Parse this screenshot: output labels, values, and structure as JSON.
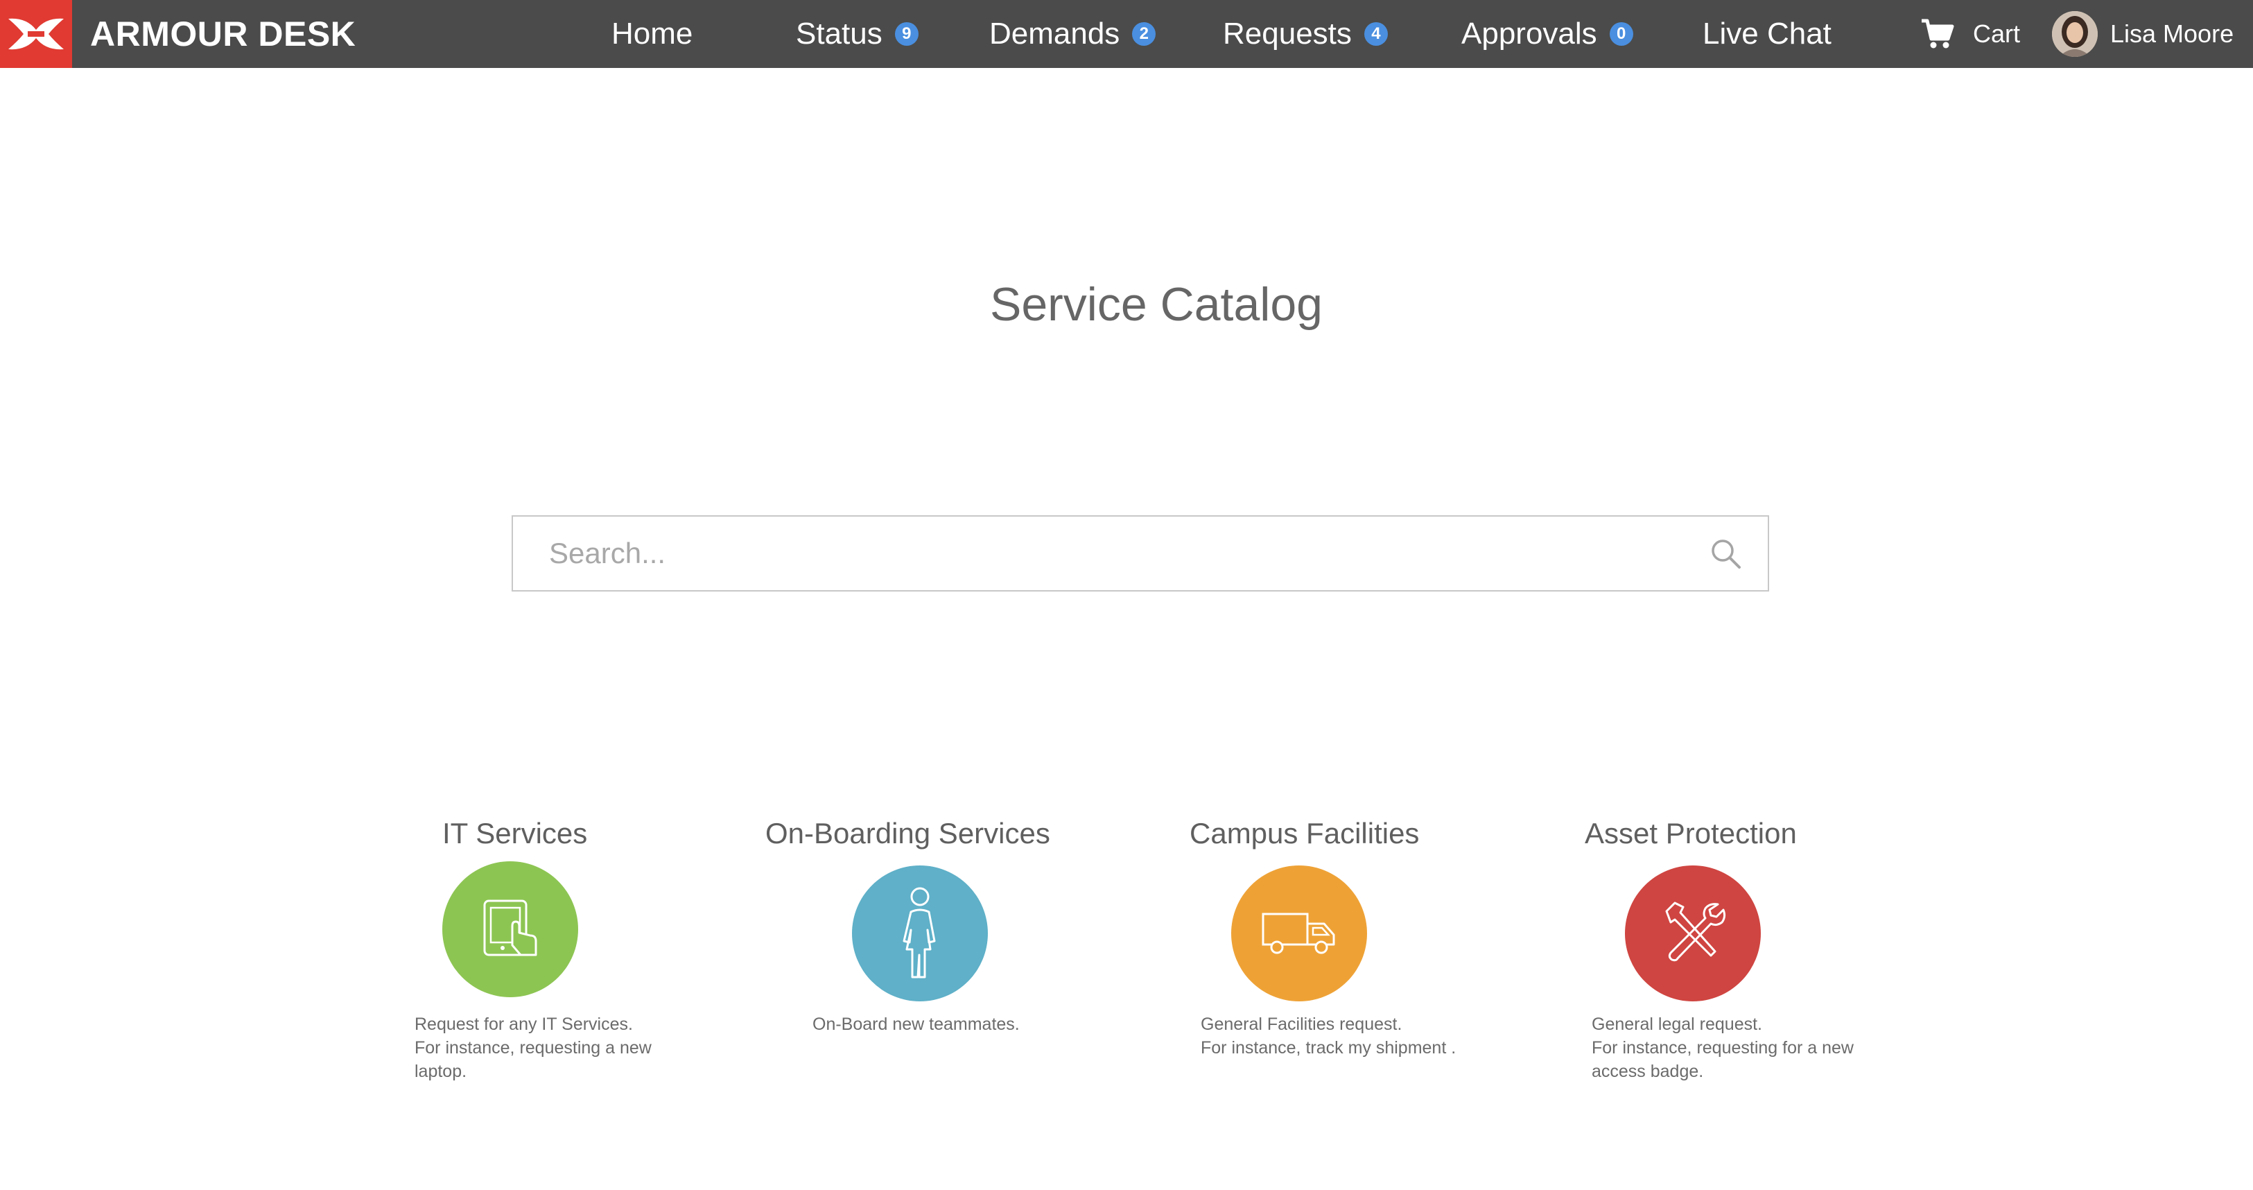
{
  "brand": {
    "name": "ARMOUR DESK",
    "accent": "#e03a32"
  },
  "nav": {
    "background": "#4b4b4b",
    "badge_color": "#4a8fe0",
    "items": [
      {
        "label": "Home",
        "badge": ""
      },
      {
        "label": "Status",
        "badge": "9"
      },
      {
        "label": "Demands",
        "badge": "2"
      },
      {
        "label": "Requests",
        "badge": "4"
      },
      {
        "label": "Approvals",
        "badge": "0"
      },
      {
        "label": "Live Chat",
        "badge": ""
      }
    ],
    "cart": {
      "label": "Cart",
      "icon": "cart-icon"
    },
    "user": {
      "name": "Lisa Moore",
      "icon": "avatar"
    }
  },
  "page": {
    "title": "Service Catalog"
  },
  "search": {
    "placeholder": "Search...",
    "value": "",
    "icon": "search-icon"
  },
  "categories": [
    {
      "title": "IT Services",
      "color": "#8dc553",
      "icon": "tablet-touch-icon",
      "description": [
        "Request for any IT Services.",
        "For instance, requesting a new",
        "laptop."
      ]
    },
    {
      "title": "On-Boarding Services",
      "color": "#5fb0c8",
      "icon": "person-icon",
      "description": [
        "On-Board new teammates."
      ]
    },
    {
      "title": "Campus Facilities",
      "color": "#eea236",
      "icon": "truck-icon",
      "description": [
        "General Facilities request.",
        "For instance, track my shipment ."
      ]
    },
    {
      "title": "Asset Protection",
      "color": "#cf4541",
      "icon": "tools-icon",
      "description": [
        "General legal request.",
        "For instance, requesting for a new",
        "access badge."
      ]
    }
  ]
}
